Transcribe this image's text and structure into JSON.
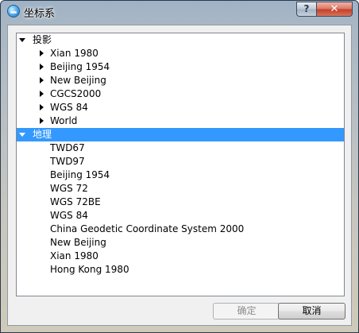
{
  "window": {
    "title": "坐标系",
    "help_label": "?",
    "close_label": "✕"
  },
  "tree": {
    "groups": [
      {
        "label": "投影",
        "expanded": true,
        "selected": false,
        "items": [
          {
            "label": "Xian 1980",
            "expandable": true
          },
          {
            "label": "Beijing 1954",
            "expandable": true
          },
          {
            "label": "New Beijing",
            "expandable": true
          },
          {
            "label": "CGCS2000",
            "expandable": true
          },
          {
            "label": "WGS 84",
            "expandable": true
          },
          {
            "label": "World",
            "expandable": true
          }
        ]
      },
      {
        "label": "地理",
        "expanded": true,
        "selected": true,
        "items": [
          {
            "label": "TWD67",
            "expandable": false
          },
          {
            "label": "TWD97",
            "expandable": false
          },
          {
            "label": "Beijing 1954",
            "expandable": false
          },
          {
            "label": "WGS 72",
            "expandable": false
          },
          {
            "label": "WGS 72BE",
            "expandable": false
          },
          {
            "label": "WGS 84",
            "expandable": false
          },
          {
            "label": "China Geodetic Coordinate System 2000",
            "expandable": false
          },
          {
            "label": "New Beijing",
            "expandable": false
          },
          {
            "label": "Xian 1980",
            "expandable": false
          },
          {
            "label": "Hong Kong 1980",
            "expandable": false
          }
        ]
      }
    ]
  },
  "buttons": {
    "ok_label": "确定",
    "ok_enabled": false,
    "cancel_label": "取消"
  },
  "colors": {
    "selection": "#3399ff",
    "close_button": "#c4412a"
  }
}
